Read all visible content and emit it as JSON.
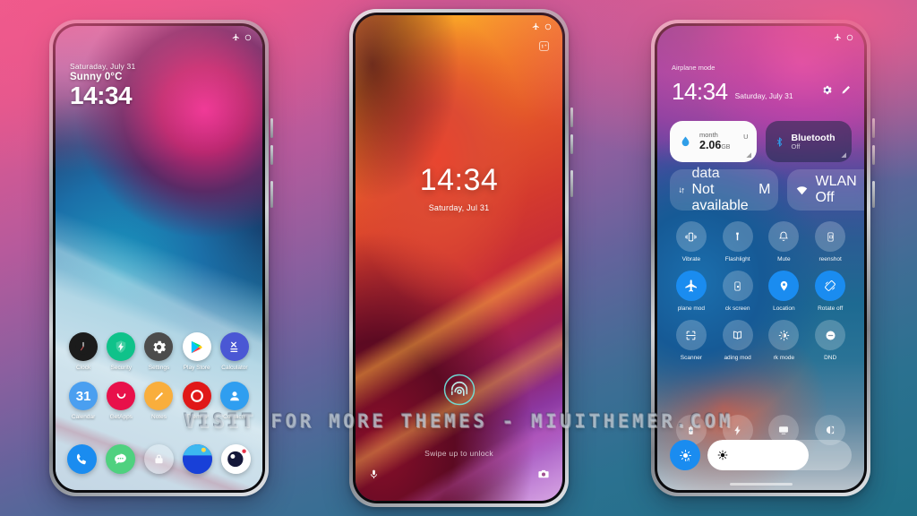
{
  "background": {
    "gradient_from": "#ef5c8e",
    "gradient_mid": "#64639c",
    "gradient_to": "#1f6f86"
  },
  "watermark": {
    "text": "VISIT  FOR  MORE  THEMES  -  MIUITHEMER.COM"
  },
  "phone_left": {
    "name": "home-screen",
    "status": {
      "airplane_icon": "airplane-icon",
      "battery_icon": "battery-circle-icon"
    },
    "lock_widget": {
      "date": "Saturaday, July 31",
      "weather": "Sunny 0°C",
      "time": "14:34"
    },
    "apps_row1": [
      {
        "label": "Clock",
        "icon": "clock-icon",
        "bg": "#1b1b1b"
      },
      {
        "label": "Security",
        "icon": "shield-bolt-icon",
        "bg": "#0fc28a"
      },
      {
        "label": "Settings",
        "icon": "gear-icon",
        "bg": "#4c4c4c"
      },
      {
        "label": "Play Store",
        "icon": "play-store-icon",
        "bg": "#ffffff"
      },
      {
        "label": "Calculator",
        "icon": "calculator-icon",
        "bg": "#4a57d4"
      }
    ],
    "apps_row2": [
      {
        "label": "Calendar",
        "icon": "calendar-31-icon",
        "bg": "#4a9ff0"
      },
      {
        "label": "GetApps",
        "icon": "getapps-smile-icon",
        "bg": "#e8104a"
      },
      {
        "label": "Notes",
        "icon": "pencil-note-icon",
        "bg": "#f9ae3c"
      },
      {
        "label": "Themes",
        "icon": "themes-ring-icon",
        "bg": "#e01818"
      },
      {
        "label": "Contacts",
        "icon": "contacts-person-icon",
        "bg": "#2f9ef0"
      }
    ],
    "dock": [
      {
        "label": "Phone",
        "icon": "phone-handset-icon",
        "bg": "#1a8cf0"
      },
      {
        "label": "Messages",
        "icon": "message-bubble-icon",
        "bg": "#4fd17f"
      },
      {
        "label": "Vault",
        "icon": "lock-bag-icon",
        "bg": "rgba(255,255,255,0.28)"
      },
      {
        "label": "Browser",
        "icon": "browser-globe-icon",
        "bg": "#1840d8"
      },
      {
        "label": "Camera",
        "icon": "camera-lens-icon",
        "bg": "#ffffff"
      }
    ]
  },
  "phone_center": {
    "name": "lock-screen",
    "status": {
      "airplane_icon": "airplane-icon",
      "battery_icon": "battery-circle-icon"
    },
    "brand_badge": "oneplus-logo-icon",
    "time": "14:34",
    "date": "Saturday, Jul 31",
    "fingerprint_icon": "fingerprint-icon",
    "unlock_hint": "Swipe up to unlock",
    "shortcut_left": {
      "label": "Voice assistant",
      "icon": "microphone-icon"
    },
    "shortcut_right": {
      "label": "Camera",
      "icon": "camera-icon"
    }
  },
  "phone_right": {
    "name": "quick-settings",
    "status": {
      "airplane_icon": "airplane-icon",
      "battery_icon": "battery-circle-icon"
    },
    "airplane_label": "Airplane mode",
    "time": "14:34",
    "date": "Saturday, July 31",
    "settings_icon": "gear-icon",
    "edit_icon": "pencil-icon",
    "tiles_large": [
      {
        "name": "data-usage-tile",
        "icon": "water-drop-icon",
        "title": "month",
        "value": "2.06",
        "unit": "GB",
        "badge": "U",
        "style": "light"
      },
      {
        "name": "bluetooth-tile",
        "icon": "bluetooth-icon",
        "title": "Bluetooth",
        "status": "Off",
        "style": "dark"
      }
    ],
    "tiles_large2": [
      {
        "name": "mobile-data-tile",
        "icon": "data-arrows-icon",
        "title": "data",
        "status": "Not available",
        "badge": "M"
      },
      {
        "name": "wlan-tile",
        "icon": "wifi-icon",
        "title": "WLAN",
        "status": "Off"
      }
    ],
    "tiles_row1": [
      {
        "label": "Vibrate",
        "icon": "vibrate-icon",
        "on": false
      },
      {
        "label": "Flashlight",
        "icon": "flashlight-icon",
        "on": false
      },
      {
        "label": "Mute",
        "icon": "bell-icon",
        "on": false
      },
      {
        "label": "reenshot",
        "icon": "screenshot-icon",
        "on": false
      }
    ],
    "tiles_row2": [
      {
        "label": "plane mod",
        "icon": "airplane-icon",
        "on": true
      },
      {
        "label": "ck screen",
        "icon": "lock-screen-icon",
        "on": false
      },
      {
        "label": "Location",
        "icon": "location-pin-icon",
        "on": true
      },
      {
        "label": "Rotate off",
        "icon": "rotate-icon",
        "on": true
      }
    ],
    "tiles_row3": [
      {
        "label": "Scanner",
        "icon": "scanner-frame-icon",
        "on": false
      },
      {
        "label": "ading mod",
        "icon": "reading-book-icon",
        "on": false
      },
      {
        "label": "rk mode",
        "icon": "dark-mode-sun-icon",
        "on": false
      },
      {
        "label": "DND",
        "icon": "dnd-minus-icon",
        "on": false
      }
    ],
    "tiles_row4": [
      {
        "label": "",
        "icon": "battery-saver-icon",
        "on": false
      },
      {
        "label": "",
        "icon": "lightning-bolt-icon",
        "on": false
      },
      {
        "label": "",
        "icon": "cast-screen-icon",
        "on": false
      },
      {
        "label": "",
        "icon": "contrast-icon",
        "on": false
      }
    ],
    "brightness": {
      "auto_icon": "auto-brightness-icon",
      "slider_icon": "brightness-sun-icon",
      "level_percent": 70
    }
  }
}
